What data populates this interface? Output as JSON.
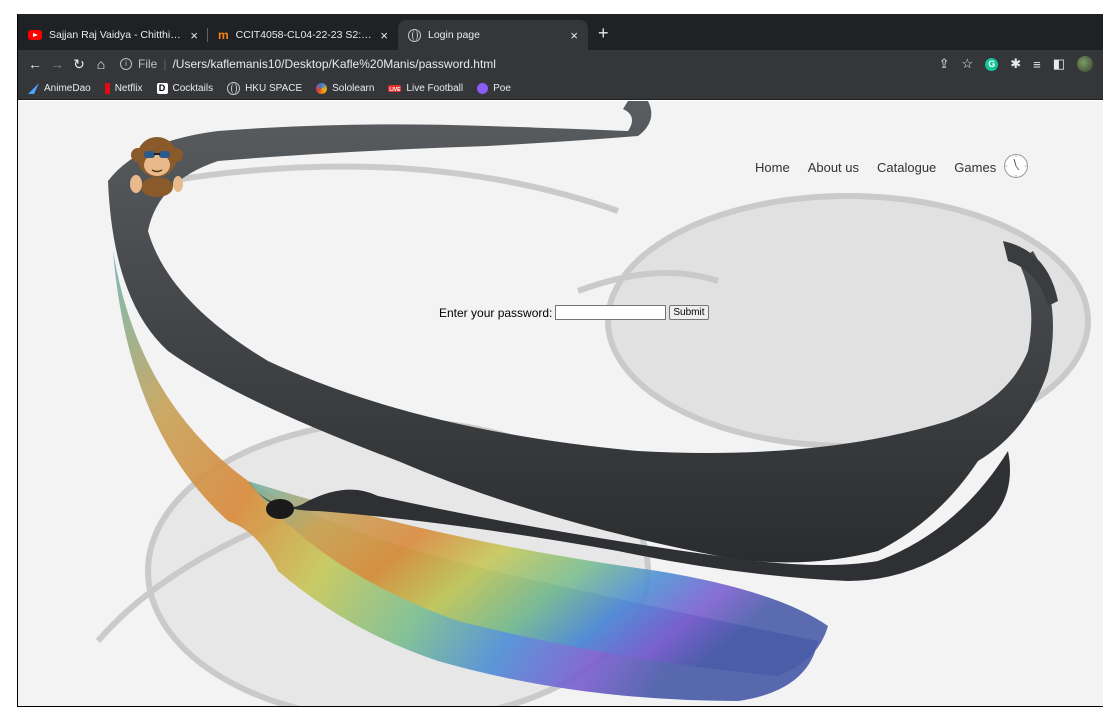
{
  "browser": {
    "tabs": [
      {
        "title": "Sajjan Raj Vaidya - Chitthi Bhitr",
        "icon": "youtube-icon",
        "active": false
      },
      {
        "title": "CCIT4058-CL04-22-23 S2: Pr",
        "icon": "moodle-icon",
        "active": false
      },
      {
        "title": "Login page",
        "icon": "globe-icon",
        "active": true
      }
    ],
    "new_tab": "+",
    "url_prefix": "File",
    "url": "/Users/kaflemanis10/Desktop/Kafle%20Manis/password.html",
    "bookmarks": [
      {
        "label": "AnimeDao",
        "icon": "animedao-icon"
      },
      {
        "label": "Netflix",
        "icon": "netflix-icon"
      },
      {
        "label": "Cocktails",
        "icon": "cocktails-icon"
      },
      {
        "label": "HKU SPACE",
        "icon": "globe-icon"
      },
      {
        "label": "Sololearn",
        "icon": "sololearn-icon"
      },
      {
        "label": "Live Football",
        "icon": "live-icon"
      },
      {
        "label": "Poe",
        "icon": "poe-icon"
      }
    ]
  },
  "page": {
    "nav": [
      {
        "label": "Home"
      },
      {
        "label": "About us"
      },
      {
        "label": "Catalogue"
      },
      {
        "label": "Games"
      }
    ],
    "login": {
      "label": "Enter your password:",
      "input_value": "",
      "submit_label": "Submit"
    }
  },
  "colors": {
    "chrome_dark": "#202124",
    "chrome_toolbar": "#35363a",
    "page_text": "#333333"
  }
}
